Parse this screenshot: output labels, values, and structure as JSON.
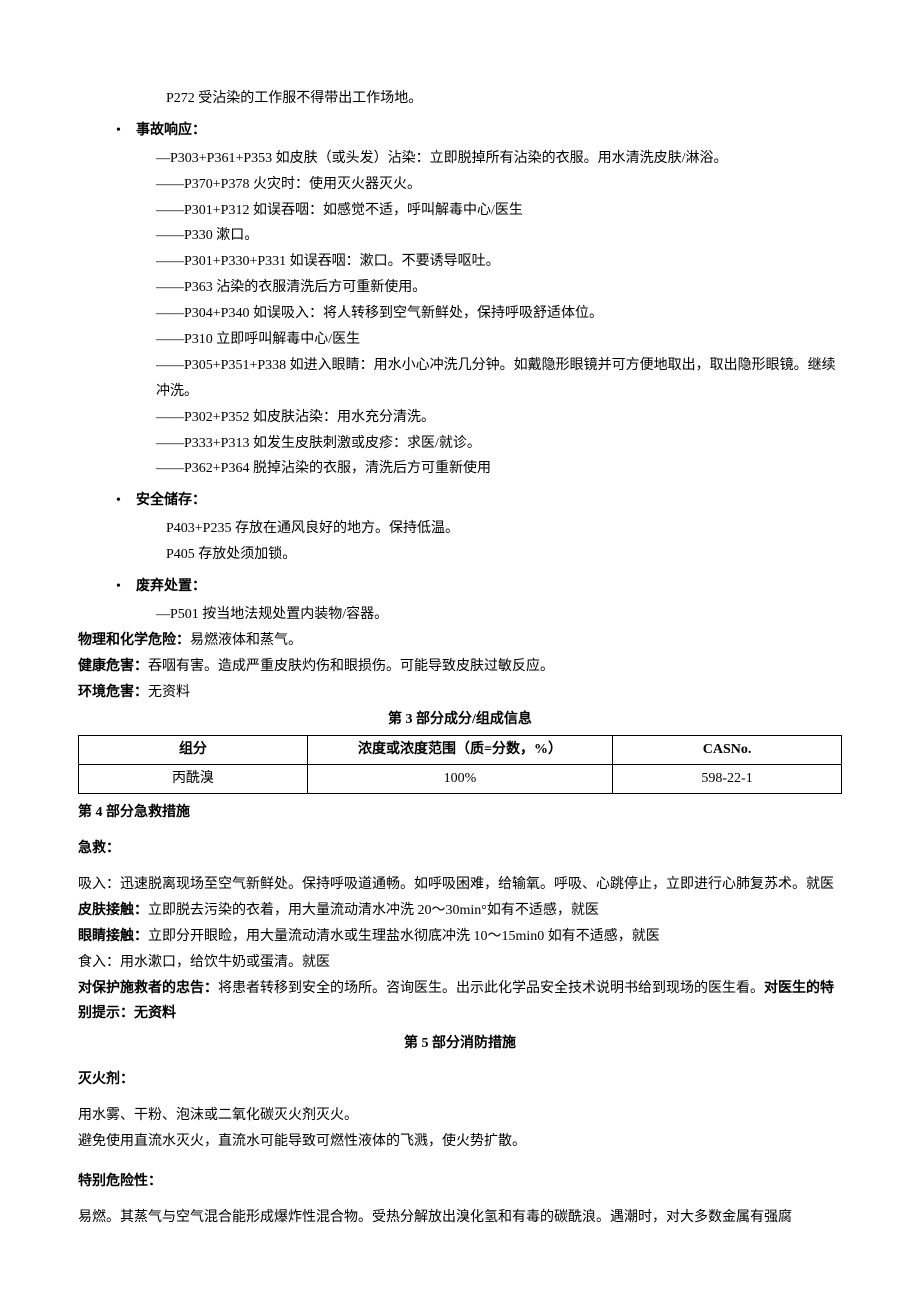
{
  "top_line": "P272 受沾染的工作服不得带出工作场地。",
  "incident": {
    "title": "事故响应：",
    "lines": [
      "—P303+P361+P353 如皮肤（或头发）沾染：立即脱掉所有沾染的衣服。用水清洗皮肤/淋浴。",
      "——P370+P378 火灾时：使用灭火器灭火。",
      "——P301+P312 如误吞咽：如感觉不适，呼叫解毒中心/医生",
      "——P330 漱口。",
      "——P301+P330+P331 如误吞咽：漱口。不要诱导呕吐。",
      "——P363 沾染的衣服清洗后方可重新使用。",
      "——P304+P340 如误吸入：将人转移到空气新鲜处，保持呼吸舒适体位。",
      "——P310 立即呼叫解毒中心/医生",
      "——P305+P351+P338 如进入眼睛：用水小心冲洗几分钟。如戴隐形眼镜并可方便地取出，取出隐形眼镜。继续冲洗。",
      "——P302+P352 如皮肤沾染：用水充分清洗。",
      "——P333+P313 如发生皮肤刺激或皮疹：求医/就诊。",
      "——P362+P364 脱掉沾染的衣服，清洗后方可重新使用"
    ]
  },
  "storage": {
    "title": "安全储存：",
    "lines": [
      "P403+P235 存放在通风良好的地方。保持低温。",
      "P405 存放处须加锁。"
    ]
  },
  "disposal": {
    "title": "废弃处置：",
    "lines": [
      "—P501 按当地法规处置内装物/容器。"
    ]
  },
  "hazards": {
    "phys_label": "物理和化学危险：",
    "phys_value": "易燃液体和蒸气。",
    "health_label": "健康危害：",
    "health_value": "吞咽有害。造成严重皮肤灼伤和眼损伤。可能导致皮肤过敏反应。",
    "env_label": "环境危害：",
    "env_value": "无资料"
  },
  "section3": {
    "heading": "第 3 部分成分/组成信息",
    "headers": [
      "组分",
      "浓度或浓度范围（质=分数，%）",
      "CASNo."
    ],
    "rows": [
      [
        "丙酰溴",
        "100%",
        "598-22-1"
      ]
    ]
  },
  "section4": {
    "heading": "第 4 部分急救措施",
    "first_aid_label": "急救：",
    "inhale": "吸入：迅速脱离现场至空气新鲜处。保持呼吸道通畅。如呼吸困难，给输氧。呼吸、心跳停止，立即进行心肺复苏术。就医",
    "skin_label": "皮肤接触：",
    "skin_value": "立即脱去污染的衣着，用大量流动清水冲洗 20～30min°如有不适感，就医",
    "eye_label": "眼睛接触：",
    "eye_value": "立即分开眼睑，用大量流动清水或生理盐水彻底冲洗 10～15min0 如有不适感，就医",
    "ingest": "食入：用水漱口，给饮牛奶或蛋清。就医",
    "rescuer_label": "对保护施救者的忠告：",
    "rescuer_value": "将患者转移到安全的场所。咨询医生。出示此化学品安全技术说明书给到现场的医生看。",
    "doctor_label": "对医生的特别提示：无资料"
  },
  "section5": {
    "heading": "第 5 部分消防措施",
    "extinguisher_label": "灭火剂：",
    "ext_line1": "用水雾、干粉、泡沫或二氧化碳灭火剂灭火。",
    "ext_line2": "避免使用直流水灭火，直流水可能导致可燃性液体的飞溅，使火势扩散。",
    "danger_label": "特别危险性：",
    "danger_value": "易燃。其蒸气与空气混合能形成爆炸性混合物。受热分解放出溴化氢和有毒的碳酰浪。遇潮时，对大多数金属有强腐"
  }
}
